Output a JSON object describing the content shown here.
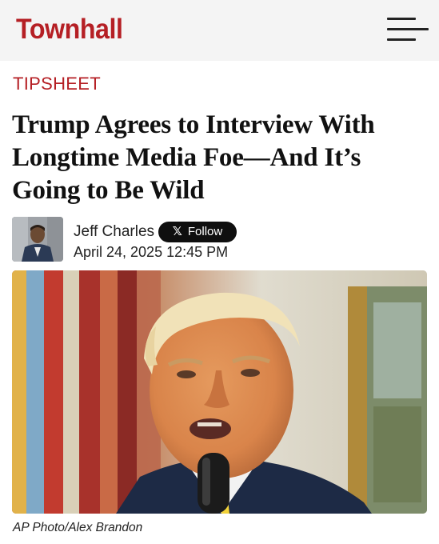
{
  "header": {
    "logo": "Townhall",
    "menu_icon": "hamburger-menu-icon"
  },
  "article": {
    "section": "TIPSHEET",
    "headline": "Trump Agrees to Interview With Longtime Media Foe—And It’s Going to Be Wild",
    "author": {
      "name": "Jeff Charles",
      "follow_label": "Follow",
      "follow_icon": "x-logo-icon"
    },
    "date": "April 24, 2025 12:45 PM",
    "image_caption": "AP Photo/Alex Brandon"
  },
  "colors": {
    "brand": "#b51f24",
    "follow_bg": "#0f0f0f",
    "header_bg": "#f4f4f4"
  }
}
